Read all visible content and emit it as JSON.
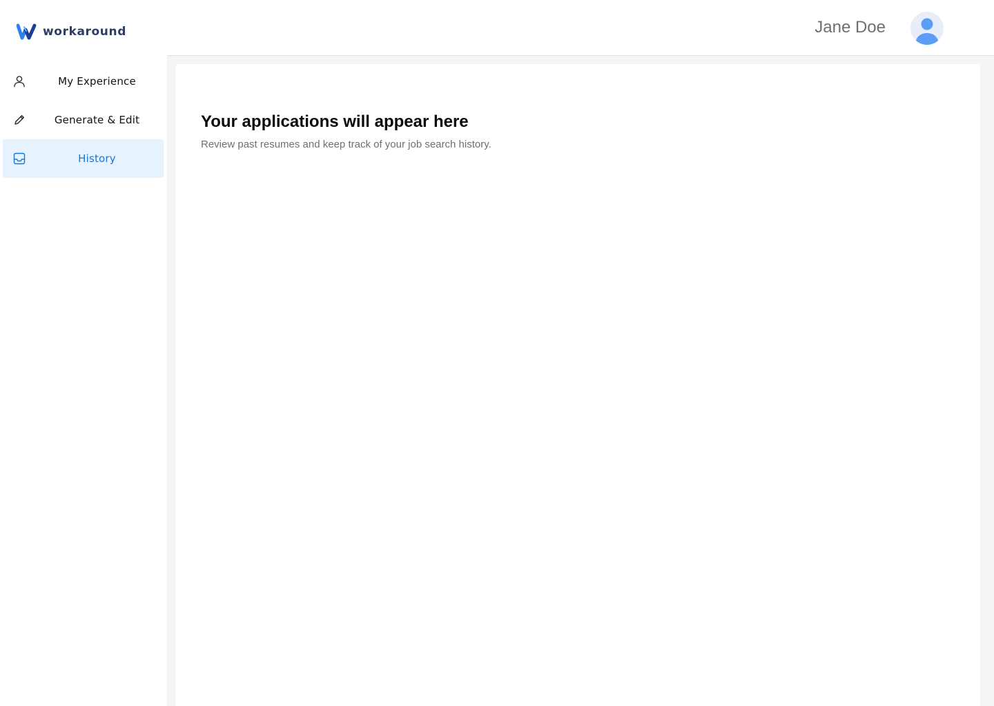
{
  "brand": {
    "name": "workaround",
    "logo_icon": "w-logo-icon",
    "colors": {
      "primary": "#2f80ed",
      "secondary": "#1c3f94",
      "text": "#2f3d63"
    }
  },
  "sidebar": {
    "items": [
      {
        "label": "My Experience",
        "icon": "user-icon",
        "active": false
      },
      {
        "label": "Generate & Edit",
        "icon": "pencil-icon",
        "active": false
      },
      {
        "label": "History",
        "icon": "inbox-icon",
        "active": true
      }
    ],
    "active_color": "#1976d2",
    "active_bg": "#e6f3fe"
  },
  "header": {
    "user_name": "Jane Doe",
    "avatar_icon": "avatar-icon",
    "avatar_color": "#5b9cf5"
  },
  "main": {
    "title": "Your applications will appear here",
    "subtitle": "Review past resumes and keep track of your job search history."
  }
}
